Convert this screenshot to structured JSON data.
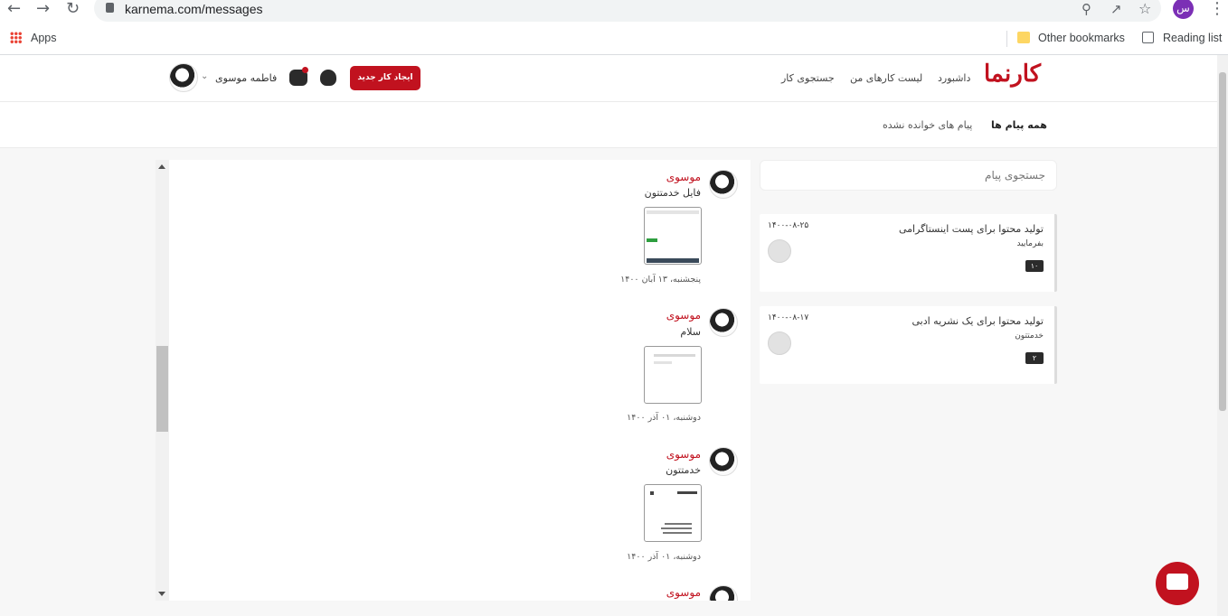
{
  "browser": {
    "url": "karnema.com/messages",
    "profile_initial": "س",
    "apps_label": "Apps",
    "other_bookmarks": "Other bookmarks",
    "reading_list": "Reading list"
  },
  "header": {
    "logo": "کارنما",
    "nav": [
      "داشبورد",
      "لیست کارهای من",
      "جستجوی کار"
    ],
    "new_job_button": "ایجاد کار جدید",
    "user_name": "فاطمه موسوی"
  },
  "tabs": [
    "همه پیام ها",
    "پیام های خوانده نشده"
  ],
  "search": {
    "placeholder": "جستجوی پیام"
  },
  "conversations": [
    {
      "title": "تولید محتوا برای پست اینستاگرامی",
      "subtitle": "بفرمایید",
      "date": "۱۴۰۰-۰۸-۲۵",
      "count": "۱۰"
    },
    {
      "title": "تولید محتوا برای یک نشریه ادبی",
      "subtitle": "خدمتتون",
      "date": "۱۴۰۰-۰۸-۱۷",
      "count": "۲"
    }
  ],
  "messages": [
    {
      "sender": "موسوی",
      "text": "فایل خدمتتون",
      "date": "پنجشنبه، ۱۳ آبان ۱۴۰۰"
    },
    {
      "sender": "موسوی",
      "text": "سلام",
      "date": "دوشنبه، ۰۱ آذر ۱۴۰۰"
    },
    {
      "sender": "موسوی",
      "text": "خدمتتون",
      "date": "دوشنبه، ۰۱ آذر ۱۴۰۰"
    },
    {
      "sender": "موسوی",
      "text": "",
      "date": ""
    }
  ],
  "colors": {
    "brand": "#c1121f"
  }
}
